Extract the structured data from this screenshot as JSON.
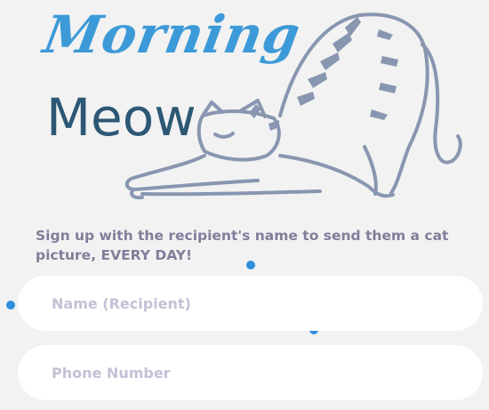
{
  "logo": {
    "title_line1": "Morning",
    "title_line2": "Meow",
    "cat_icon": "stretching-cat-icon"
  },
  "colors": {
    "accent_blue": "#3d9ad8",
    "dark_teal": "#2c5875",
    "description_text": "#807e9a",
    "placeholder": "#c2c2d6",
    "marker_dot": "#2f8fde",
    "background": "#f2f2f2"
  },
  "signup": {
    "description": "Sign up with the recipient's name to send them a cat picture, EVERY DAY!",
    "name_placeholder": "Name (Recipient)",
    "phone_placeholder": "Phone Number"
  }
}
